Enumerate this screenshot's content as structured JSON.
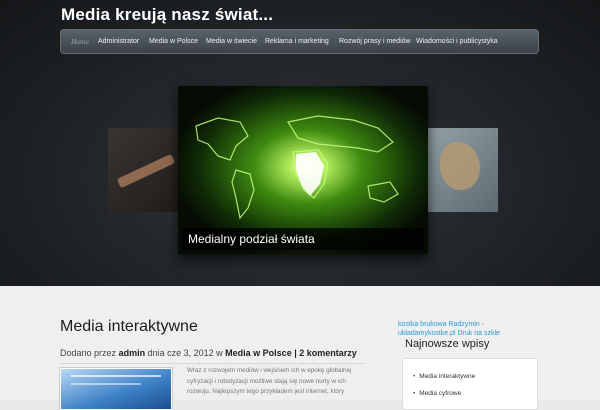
{
  "site": {
    "title": "Media kreują nasz świat..."
  },
  "nav": {
    "items": [
      {
        "label": "Home"
      },
      {
        "label": "Administrator"
      },
      {
        "label": "Media w Polsce"
      },
      {
        "label": "Media w świecie"
      },
      {
        "label": "Reklama i marketing"
      },
      {
        "label": "Rozwój prasy i mediów"
      },
      {
        "label": "Wiadomości i publicystyka"
      }
    ]
  },
  "slider": {
    "caption": "Medialny podział świata"
  },
  "post": {
    "title": "Media interaktywne",
    "meta": {
      "prefix": "Dodano przez",
      "author": "admin",
      "date": "dnia cze 3, 2012 w",
      "category": "Media w Polsce",
      "separator": "|",
      "comments": "2 komentarzy"
    },
    "excerpt": [
      "Wraz z rozwojem mediów i wejściem ich w epokę globalnej",
      "cyfryzacji i robotyzacji możliwe stają się nowe nurty w ich",
      "rozwoju. Najlepszym tego przykładem jest internet, który"
    ]
  },
  "sidebar": {
    "ad_link": "kostka brukowa Radzymin - układamykostke.pl Druk na szkle",
    "widget_title": "Najnowsze wpisy",
    "recent": [
      "Media interaktywne",
      "Media cyfrowe"
    ]
  }
}
